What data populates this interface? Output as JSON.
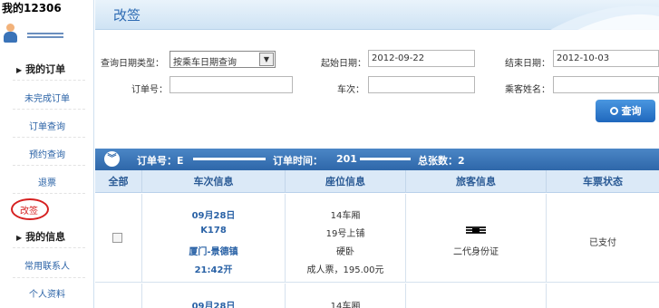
{
  "sidebar": {
    "title": "我的12306",
    "order_heading": "我的订单",
    "order_links": [
      "未完成订单",
      "订单查询",
      "预约查询",
      "退票",
      "改签"
    ],
    "info_heading": "我的信息",
    "info_links": [
      "常用联系人",
      "个人资料"
    ]
  },
  "banner": {
    "title": "改签"
  },
  "form": {
    "query_type_label": "查询日期类型：",
    "query_type_value": "按乘车日期查询",
    "start_date_label": "起始日期：",
    "start_date_value": "2012-09-22",
    "end_date_label": "结束日期：",
    "end_date_value": "2012-10-03",
    "order_no_label": "订单号：",
    "order_no_value": "",
    "train_no_label": "车次：",
    "train_no_value": "",
    "passenger_name_label": "乘客姓名：",
    "passenger_name_value": "",
    "query_button": "查询"
  },
  "table": {
    "order_no_label": "订单号：E",
    "order_time_label": "订单时间：",
    "order_time_prefix": "201",
    "total_label": "总张数：2",
    "headers": [
      "全部",
      "车次信息",
      "座位信息",
      "旅客信息",
      "车票状态"
    ],
    "rows": [
      {
        "train": [
          "09月28日",
          "K178",
          "厦门-景德镇",
          "21:42开"
        ],
        "seat": [
          "14车厢",
          "19号上铺",
          "硬卧",
          "成人票，195.00元"
        ],
        "id_type": "二代身份证",
        "status": "已支付"
      },
      {
        "train": [
          "09月28日"
        ],
        "seat": [
          "14车厢"
        ],
        "id_type": "",
        "status": ""
      }
    ]
  },
  "colors": {
    "accent": "#2a62a6",
    "header_bar": "#2e67a9",
    "highlight_circle": "#d62020"
  }
}
